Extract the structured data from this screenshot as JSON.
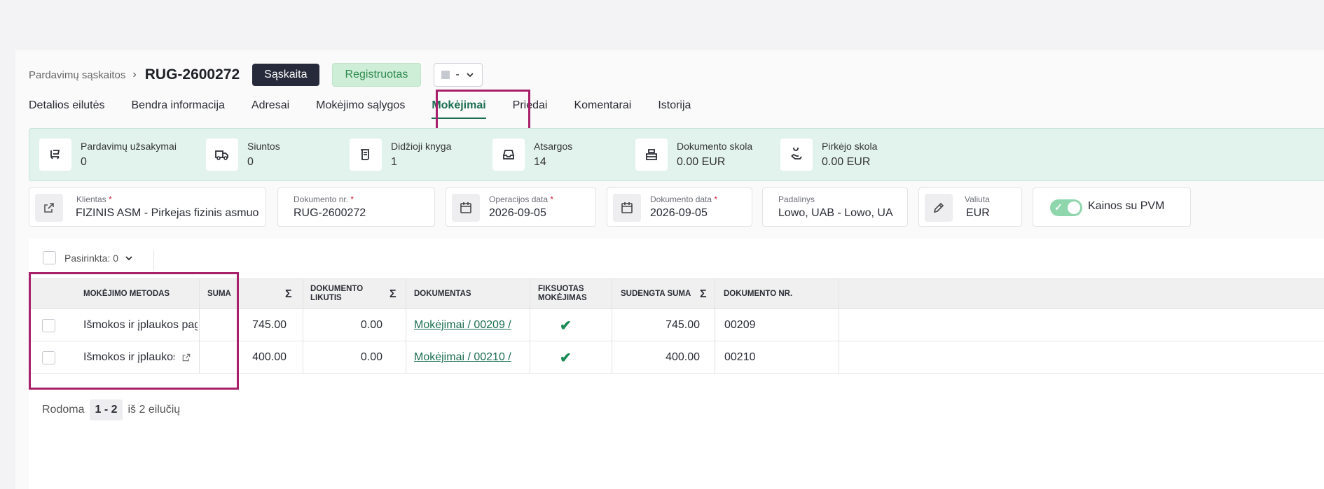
{
  "header": {
    "breadcrumb": "Pardavimų sąskaitos",
    "title": "RUG-2600272",
    "type_badge": "Sąskaita",
    "status_badge": "Registruotas",
    "status_select_value": "-"
  },
  "tabs": [
    {
      "label": "Detalios eilutės"
    },
    {
      "label": "Bendra informacija"
    },
    {
      "label": "Adresai"
    },
    {
      "label": "Mokėjimo sąlygos"
    },
    {
      "label": "Mokėjimai",
      "active": true
    },
    {
      "label": "Priedai"
    },
    {
      "label": "Komentarai"
    },
    {
      "label": "Istorija"
    }
  ],
  "stats": [
    {
      "label": "Pardavimų užsakymai",
      "value": "0",
      "icon": "cart-icon"
    },
    {
      "label": "Siuntos",
      "value": "0",
      "icon": "truck-icon"
    },
    {
      "label": "Didžioji knyga",
      "value": "1",
      "icon": "ledger-icon"
    },
    {
      "label": "Atsargos",
      "value": "14",
      "icon": "inbox-icon"
    },
    {
      "label": "Dokumento skola",
      "value": "0.00 EUR",
      "icon": "cash-register-icon"
    },
    {
      "label": "Pirkėjo skola",
      "value": "0.00 EUR",
      "icon": "hand-money-icon"
    }
  ],
  "fields": {
    "client": {
      "label": "Klientas",
      "value": "FIZINIS ASM - Pirkejas fizinis asmuo"
    },
    "doc_no": {
      "label": "Dokumento nr.",
      "value": "RUG-2600272"
    },
    "op_date": {
      "label": "Operacijos data",
      "value": "2026-09-05"
    },
    "doc_date": {
      "label": "Dokumento data",
      "value": "2026-09-05"
    },
    "division": {
      "label": "Padalinys",
      "value": "Lowo, UAB - Lowo, UAB"
    },
    "currency": {
      "label": "Valiuta",
      "value": "EUR"
    },
    "prices_vat": {
      "label": "Kainos su PVM",
      "on": true
    }
  },
  "table": {
    "selected_label": "Pasirinkta: 0",
    "sum_symbol": "Σ",
    "columns": {
      "method": "MOKĖJIMO METODAS",
      "suma": "SUMA",
      "remainder": "DOKUMENTO LIKUTIS",
      "document": "DOKUMENTAS",
      "fixed": "FIKSUOTAS MOKĖJIMAS",
      "settled": "SUDENGTA SUMA",
      "doc_no": "DOKUMENTO NR."
    },
    "rows": [
      {
        "method": "Išmokos ir įplaukos pagal dokumentą",
        "suma": "745.00",
        "remainder": "0.00",
        "document": "Mokėjimai / 00209 /",
        "fixed": "✔",
        "settled": "745.00",
        "doc_no": "00209"
      },
      {
        "method": "Išmokos ir įplaukos pagal dokumentą",
        "suma": "400.00",
        "remainder": "0.00",
        "document": "Mokėjimai / 00210 /",
        "fixed": "✔",
        "settled": "400.00",
        "doc_no": "00210"
      }
    ]
  },
  "pager": {
    "prefix": "Rodoma",
    "range": "1 - 2",
    "suffix": "iš 2 eilučių"
  },
  "colors": {
    "accent": "#1b6e50",
    "highlight": "#a8206a",
    "stats_bg": "#e2f3ed"
  }
}
